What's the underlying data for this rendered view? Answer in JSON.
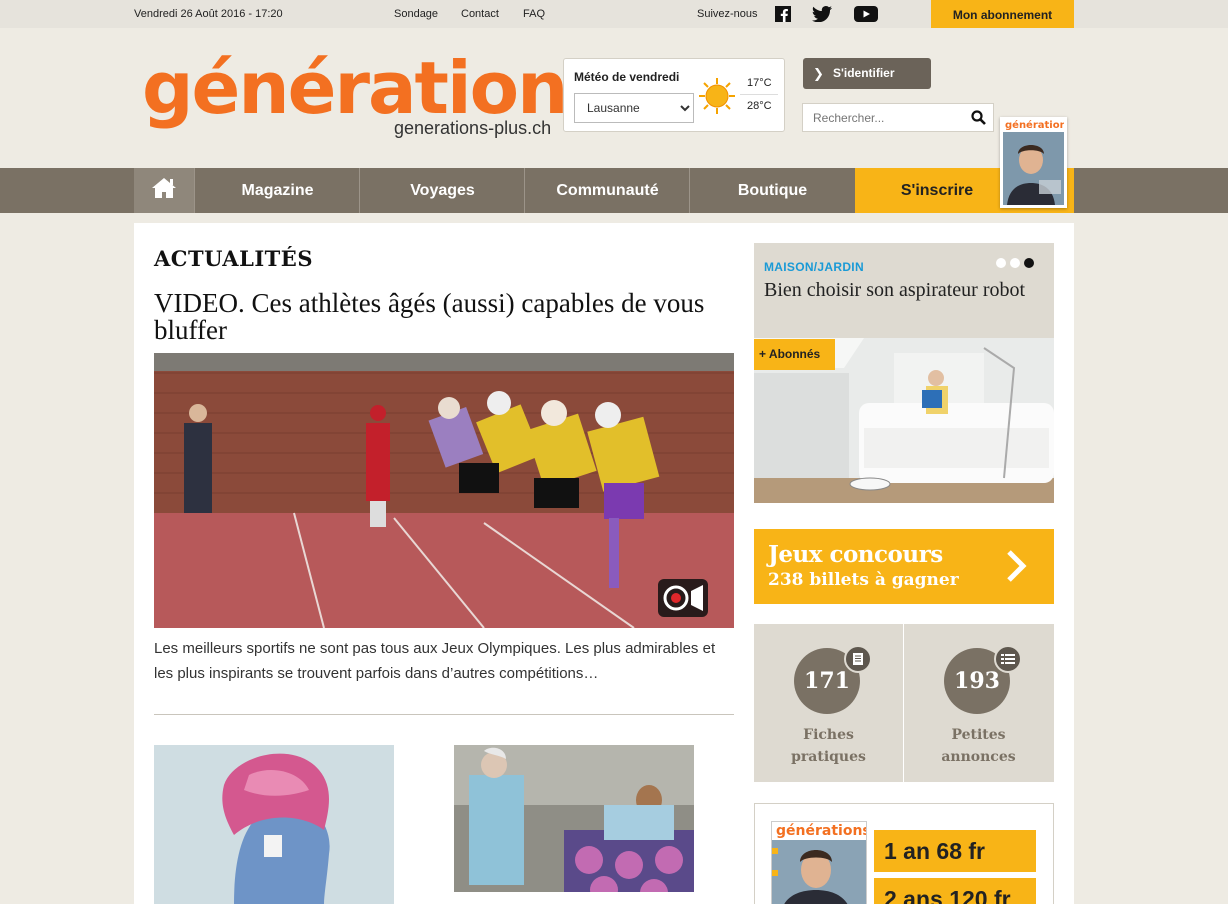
{
  "topbar": {
    "date": "Vendredi 26 Août 2016 - 17:20",
    "links": [
      "Sondage",
      "Contact",
      "FAQ"
    ],
    "follow_label": "Suivez-nous",
    "subscribe_label": "Mon abonnement"
  },
  "header": {
    "logo_text": "générations",
    "logo_subtitle": "generations-plus.ch",
    "weather": {
      "title": "Météo de vendredi",
      "city": "Lausanne",
      "temp_min": "17°C",
      "temp_max": "28°C",
      "icon": "sun-icon"
    },
    "login_label": "S'identifier",
    "search_placeholder": "Rechercher..."
  },
  "nav": {
    "home_icon": "home-icon",
    "items": [
      "Magazine",
      "Voyages",
      "Communauté",
      "Boutique"
    ],
    "signup_label": "S'inscrire",
    "magazine_thumb_title": "générations"
  },
  "main": {
    "section_title": "ACTUALITÉS",
    "headline": "VIDEO. Ces athlètes âgés (aussi) capables de vous bluffer",
    "lede": "Les meilleurs sportifs ne sont pas tous aux Jeux Olympiques. Les plus admirables et les plus inspirants se trouvent parfois dans d’autres compétitions…"
  },
  "sidebar": {
    "featured": {
      "category": "MAISON/JARDIN",
      "title": "Bien choisir son aspirateur robot",
      "badge": "+ Abonnés",
      "slides": 3,
      "active_slide": 3
    },
    "contest": {
      "line1": "Jeux concours",
      "line2": "238 billets à gagner"
    },
    "stats": [
      {
        "value": "171",
        "label_1": "Fiches",
        "label_2": "pratiques",
        "icon": "document-icon"
      },
      {
        "value": "193",
        "label_1": "Petites",
        "label_2": "annonces",
        "icon": "list-icon"
      }
    ],
    "subscription": {
      "cover_title": "générations",
      "prices": [
        "1 an 68 fr",
        "2 ans 120 fr"
      ]
    }
  },
  "colors": {
    "brand_orange": "#f37021",
    "accent_yellow": "#f8b417",
    "nav_brown": "#7a7164",
    "category_blue": "#1a9ad6"
  }
}
